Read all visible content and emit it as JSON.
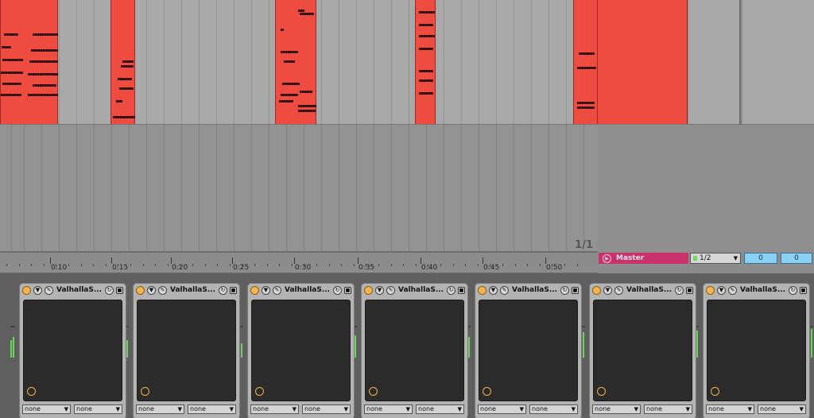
{
  "arrangement": {
    "page_counter": "1/1",
    "ruler_labels": [
      "0:10",
      "0:15",
      "0:20",
      "0:25",
      "0:30",
      "0:35",
      "0:40",
      "0:45",
      "0:50"
    ]
  },
  "session": {
    "master_label": "Master",
    "quantization": "1/2",
    "counter_a": "0",
    "counter_b": "0"
  },
  "devices": [
    {
      "title": "ValhallaS...",
      "send_a": "none",
      "send_b": "none"
    },
    {
      "title": "ValhallaS...",
      "send_a": "none",
      "send_b": "none"
    },
    {
      "title": "ValhallaS...",
      "send_a": "none",
      "send_b": "none"
    },
    {
      "title": "ValhallaS...",
      "send_a": "none",
      "send_b": "none"
    },
    {
      "title": "ValhallaS...",
      "send_a": "none",
      "send_b": "none"
    },
    {
      "title": "ValhallaS...",
      "send_a": "none",
      "send_b": "none"
    },
    {
      "title": "ValhallaS...",
      "send_a": "none",
      "send_b": "none"
    }
  ],
  "icons": {
    "power": "power-icon",
    "fold": "triangle-down-icon",
    "wrench": "wrench-icon",
    "hot_swap": "hot-swap-icon",
    "save": "save-icon",
    "play": "play-icon"
  },
  "colors": {
    "clip_red": "#ef4c41",
    "master_pink": "#c7336a",
    "meter_green": "#6cd35c",
    "power_orange": "#f5b54c",
    "counter_blue": "#8ad1f4"
  }
}
